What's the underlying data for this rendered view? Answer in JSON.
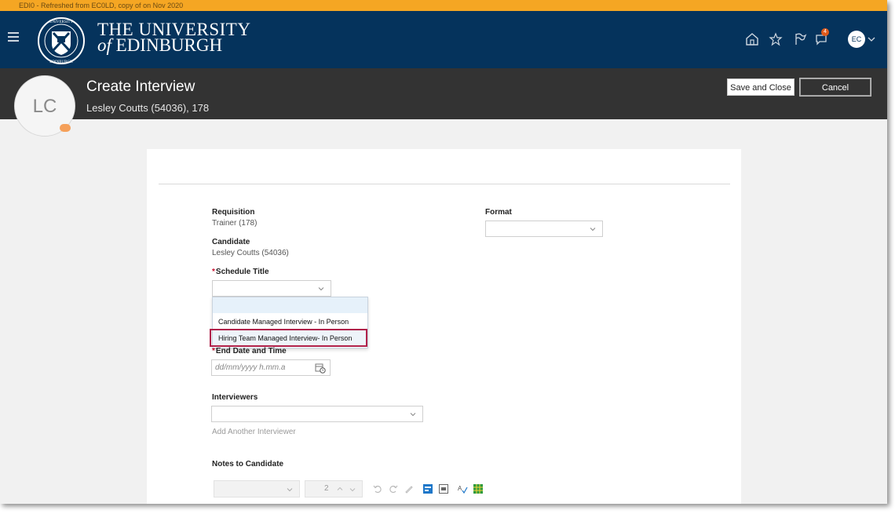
{
  "top_strip": {
    "text": "EDI0 - Refreshed from EC0LD, copy of on Nov 2020"
  },
  "brand": {
    "title_line1": "THE UNIVERSITY",
    "title_of": "of",
    "title_line2": "EDINBURGH",
    "nav_icons": [
      "menu-icon",
      "home-icon",
      "star-icon",
      "flag-icon",
      "notifications-icon"
    ],
    "notification_count": "4",
    "user_initials": "EC"
  },
  "page_header": {
    "title": "Create Interview",
    "subtitle": "Lesley Coutts (54036), 178",
    "avatar_initials": "LC",
    "save_button": "Save and Close",
    "cancel_button": "Cancel"
  },
  "form": {
    "requisition": {
      "label": "Requisition",
      "value": "Trainer (178)"
    },
    "candidate": {
      "label": "Candidate",
      "value": "Lesley Coutts (54036)"
    },
    "schedule_title": {
      "required_mark": "*",
      "label": "Schedule Title",
      "value": "",
      "options": [
        "",
        "Candidate Managed Interview - In Person",
        "Hiring Team Managed Interview- In Person"
      ],
      "highlighted_option": "Hiring Team Managed Interview- In Person"
    },
    "format": {
      "label": "Format",
      "value": ""
    },
    "end_date": {
      "required_mark": "*",
      "label": "End Date and Time",
      "placeholder": "dd/mm/yyyy h.mm.a"
    },
    "interviewers": {
      "label": "Interviewers",
      "value": "",
      "add_link": "Add Another Interviewer"
    },
    "notes": {
      "label": "Notes to Candidate",
      "toolbar": {
        "font_size": "2"
      }
    }
  },
  "colors": {
    "brand_bar": "#05335c",
    "page_header": "#333333",
    "top_strip": "#f5a623",
    "highlight": "#b0214a",
    "badge": "#e05a1b"
  }
}
